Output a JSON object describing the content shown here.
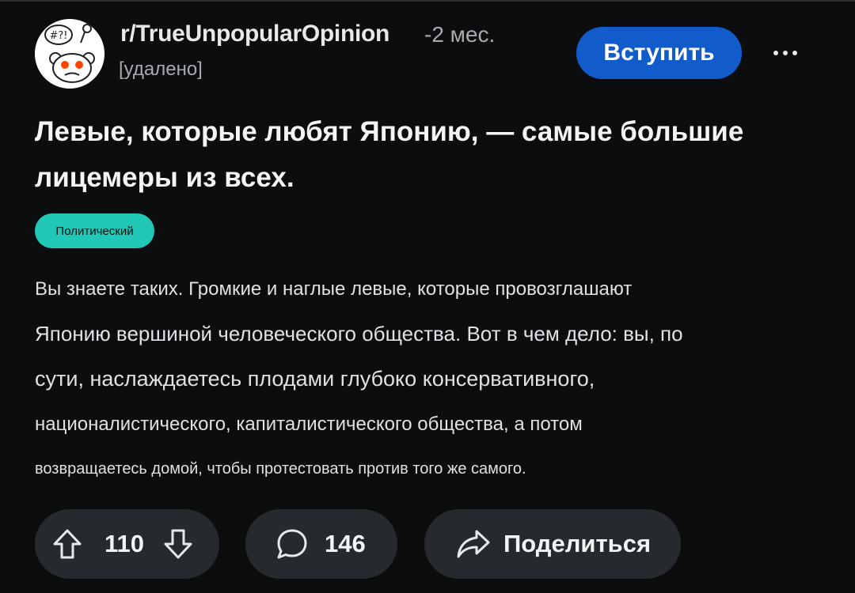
{
  "post": {
    "subreddit": "r/TrueUnpopularOpinion",
    "age": "-2 мес.",
    "author": "[удалено]",
    "join_label": "Вступить",
    "title_lines": [
      "Левые, которые любят Японию, — самые большие",
      "лицемеры из всех."
    ],
    "flair": "Политический",
    "flair_color": "#21c7b7",
    "body_lines": [
      "Вы знаете таких. Громкие и наглые левые, которые провозглашают",
      "Японию вершиной человеческого общества. Вот в чем дело: вы, по",
      "сути, наслаждаетесь плодами глубоко консервативного,",
      "националистического, капиталистического общества, а потом",
      "возвращаетесь домой, чтобы протестовать против того же самого."
    ]
  },
  "actions": {
    "upvote_icon": "arrow-up-outline-icon",
    "vote_count": "110",
    "downvote_icon": "arrow-down-outline-icon",
    "comment_icon": "speech-bubble-icon",
    "comment_count": "146",
    "share_icon": "share-arrow-icon",
    "share_label": "Поделиться"
  },
  "colors": {
    "background": "#0b0d0f",
    "join_button": "#115bca",
    "pill": "#262a2e",
    "muted_text": "#a7abaf"
  }
}
